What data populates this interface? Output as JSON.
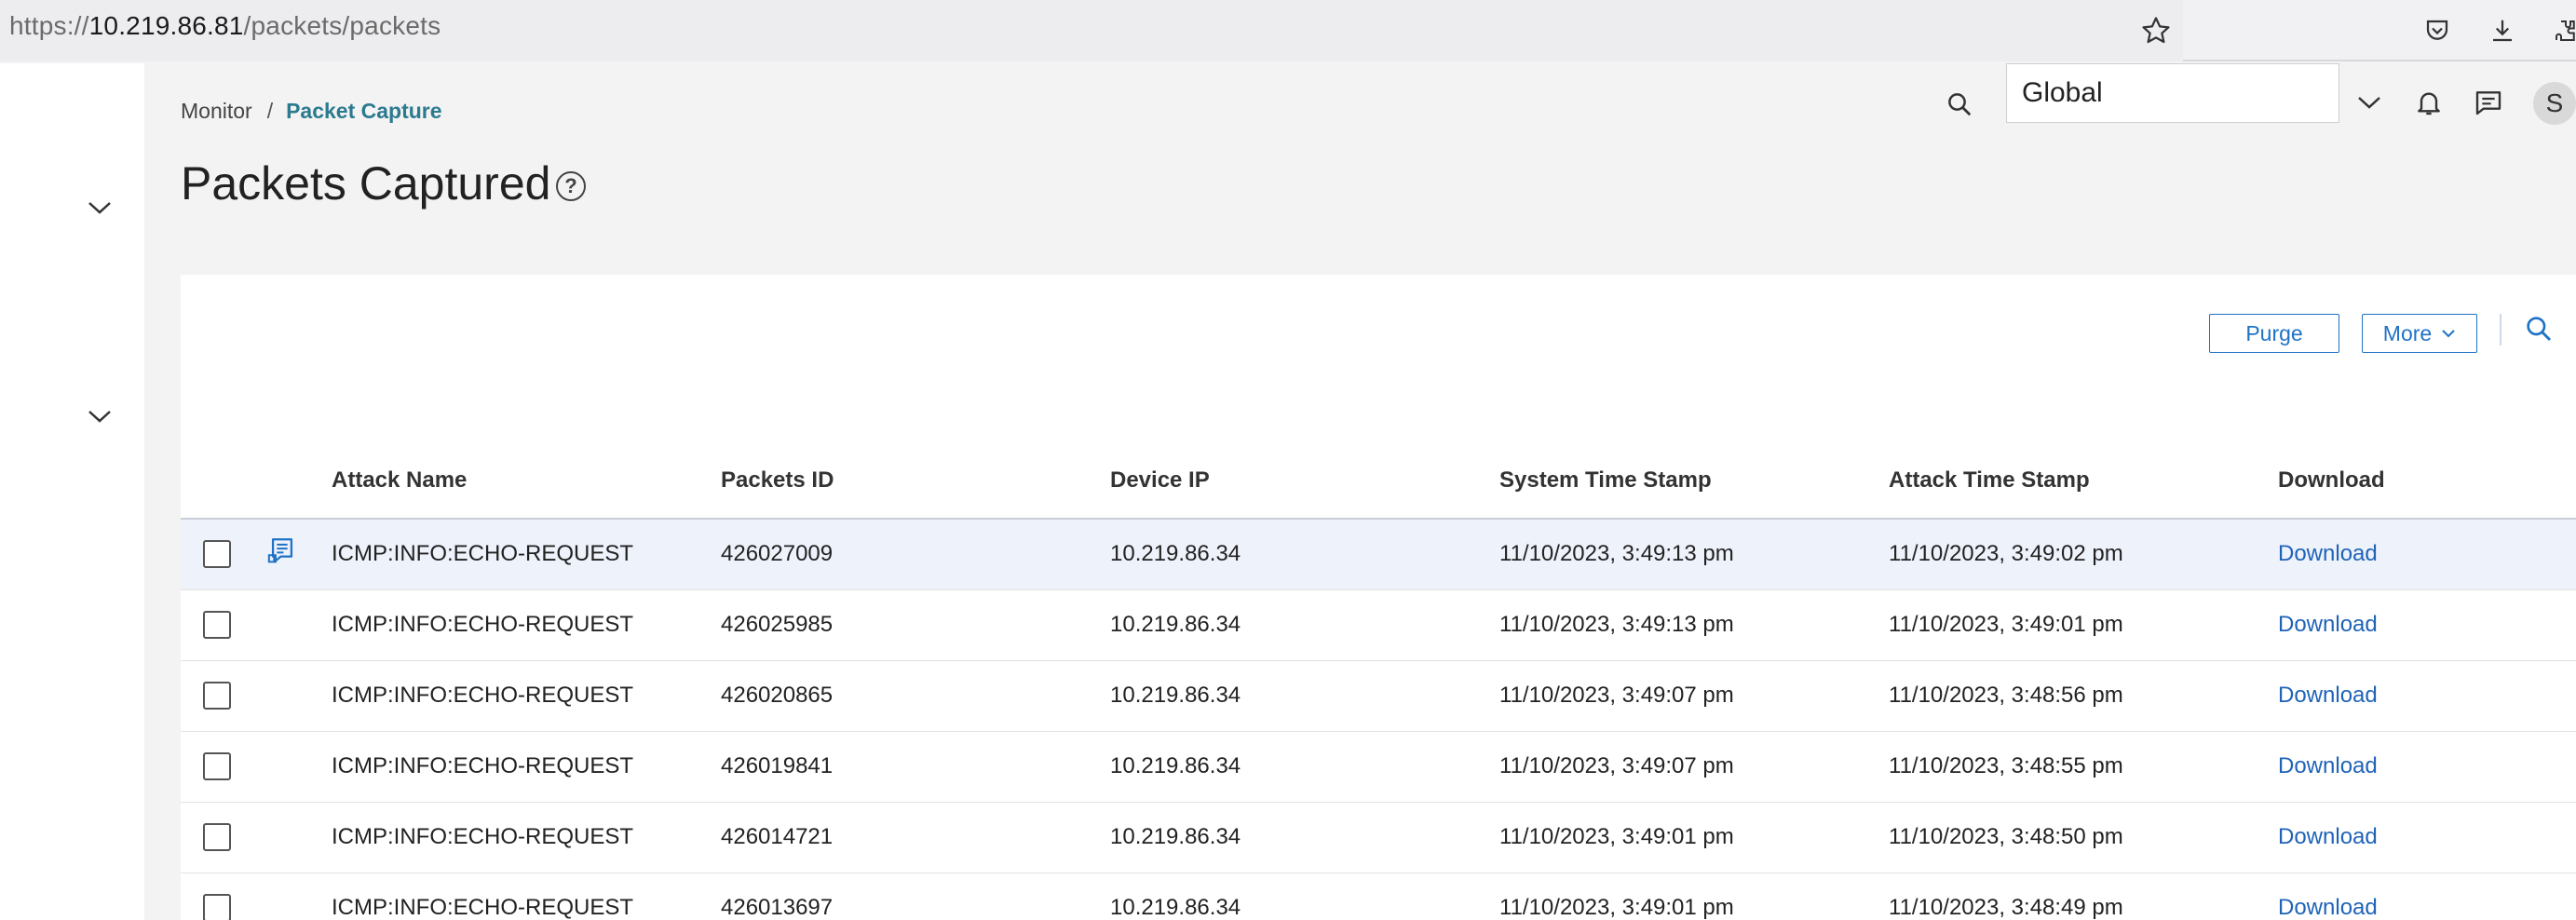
{
  "browser": {
    "url_scheme": "https://",
    "url_host": "10.219.86.81",
    "url_path": "/packets/packets"
  },
  "breadcrumb": {
    "parent": "Monitor",
    "separator": "/",
    "current": "Packet Capture"
  },
  "page": {
    "title": "Packets Captured",
    "help_glyph": "?"
  },
  "header": {
    "scope_value": "Global",
    "avatar_initial": "S"
  },
  "toolbar": {
    "purge_label": "Purge",
    "more_label": "More"
  },
  "table": {
    "columns": [
      "Attack Name",
      "Packets ID",
      "Device IP",
      "System Time Stamp",
      "Attack Time Stamp",
      "Download"
    ],
    "rows": [
      {
        "attack": "ICMP:INFO:ECHO-REQUEST",
        "pid": "426027009",
        "ip": "10.219.86.34",
        "sys": "11/10/2023, 3:49:13 pm",
        "att": "11/10/2023, 3:49:02 pm",
        "dl": "Download"
      },
      {
        "attack": "ICMP:INFO:ECHO-REQUEST",
        "pid": "426025985",
        "ip": "10.219.86.34",
        "sys": "11/10/2023, 3:49:13 pm",
        "att": "11/10/2023, 3:49:01 pm",
        "dl": "Download"
      },
      {
        "attack": "ICMP:INFO:ECHO-REQUEST",
        "pid": "426020865",
        "ip": "10.219.86.34",
        "sys": "11/10/2023, 3:49:07 pm",
        "att": "11/10/2023, 3:48:56 pm",
        "dl": "Download"
      },
      {
        "attack": "ICMP:INFO:ECHO-REQUEST",
        "pid": "426019841",
        "ip": "10.219.86.34",
        "sys": "11/10/2023, 3:49:07 pm",
        "att": "11/10/2023, 3:48:55 pm",
        "dl": "Download"
      },
      {
        "attack": "ICMP:INFO:ECHO-REQUEST",
        "pid": "426014721",
        "ip": "10.219.86.34",
        "sys": "11/10/2023, 3:49:01 pm",
        "att": "11/10/2023, 3:48:50 pm",
        "dl": "Download"
      },
      {
        "attack": "ICMP:INFO:ECHO-REQUEST",
        "pid": "426013697",
        "ip": "10.219.86.34",
        "sys": "11/10/2023, 3:49:01 pm",
        "att": "11/10/2023, 3:48:49 pm",
        "dl": "Download"
      }
    ]
  },
  "colors": {
    "accent": "#1f72c6",
    "link": "#1f63b8",
    "breadcrumb_current": "#2b7a8f",
    "selected_row": "#eef2fb"
  },
  "icons": {
    "browser": [
      "star-icon",
      "pocket-icon",
      "download-icon",
      "extensions-icon"
    ],
    "header": [
      "search-icon",
      "chevron-down-icon",
      "bell-icon",
      "message-icon"
    ],
    "panel": [
      "search-icon"
    ],
    "row": [
      "packet-details-icon"
    ]
  }
}
